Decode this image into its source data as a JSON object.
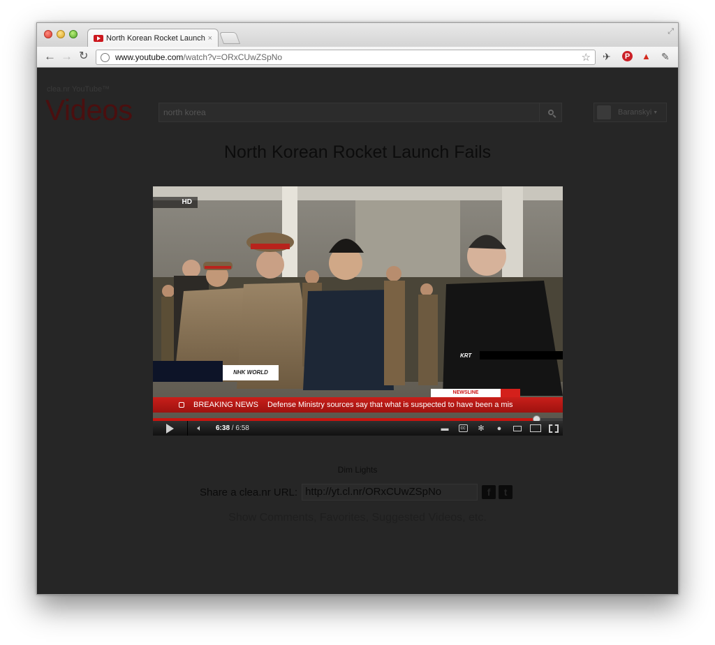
{
  "browser": {
    "tab_title": "North Korean Rocket Launch",
    "tab_close": "×",
    "url_domain": "www.youtube.com",
    "url_path": "/watch?v=ORxCUwZSpNo"
  },
  "header": {
    "brand_small": "clea.nr YouTube™",
    "brand_big": "Videos",
    "search_value": "north korea",
    "user_name": "Baranskyi"
  },
  "video": {
    "title": "North Korean Rocket Launch Fails",
    "hd_label": "HD",
    "ticker_label": "BREAKING NEWS",
    "ticker_text": "Defense Ministry sources say that what is suspected to have been a mis",
    "overlay_nhk": "NHK WORLD",
    "overlay_newsline": "NEWSLINE",
    "overlay_krt": "KRT",
    "current_time": "6:38",
    "duration": "6:58",
    "progress": 0.937
  },
  "below": {
    "dim_lights": "Dim Lights",
    "share_label": "Share a clea.nr URL:",
    "share_url": "http://yt.cl.nr/ORxCUwZSpNo",
    "show_more": "Show Comments, Favorites, Suggested Videos, etc."
  }
}
